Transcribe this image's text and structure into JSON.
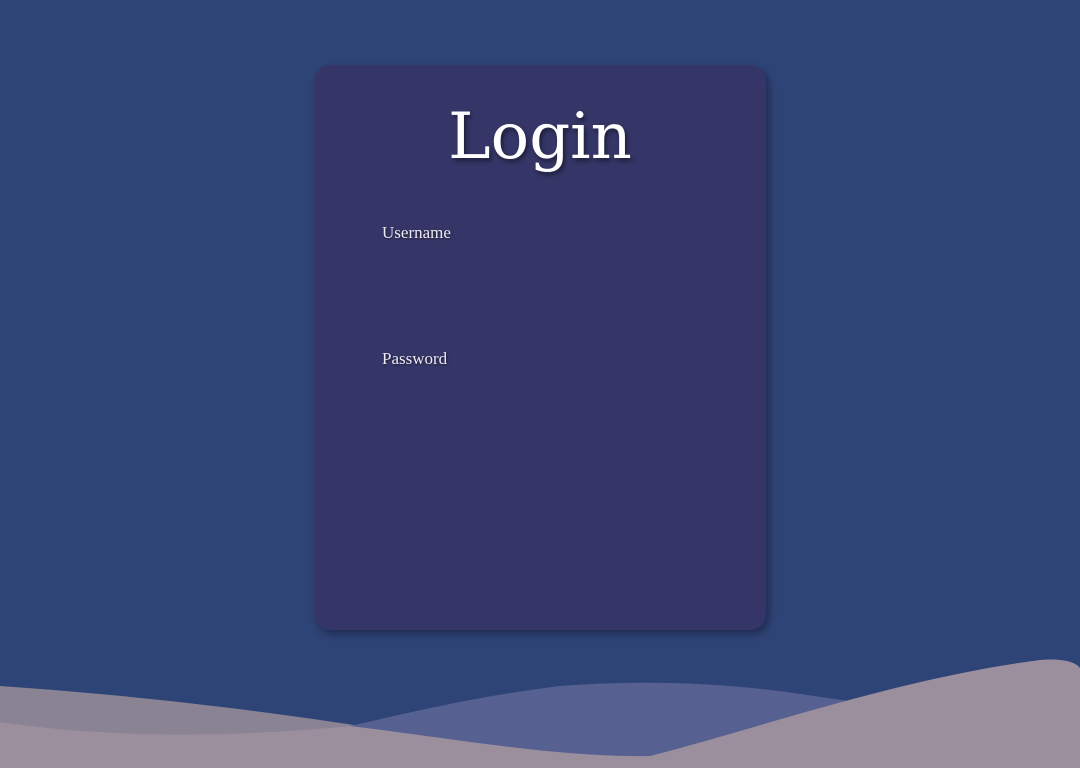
{
  "login_form": {
    "title": "Login",
    "username": {
      "label": "Username",
      "value": ""
    },
    "password": {
      "label": "Password",
      "value": ""
    }
  },
  "colors": {
    "background": "#2f4476",
    "card": "#353667",
    "wave_back": "#8a8393",
    "wave_middle": "#566191",
    "wave_front": "#9b8f9e"
  }
}
